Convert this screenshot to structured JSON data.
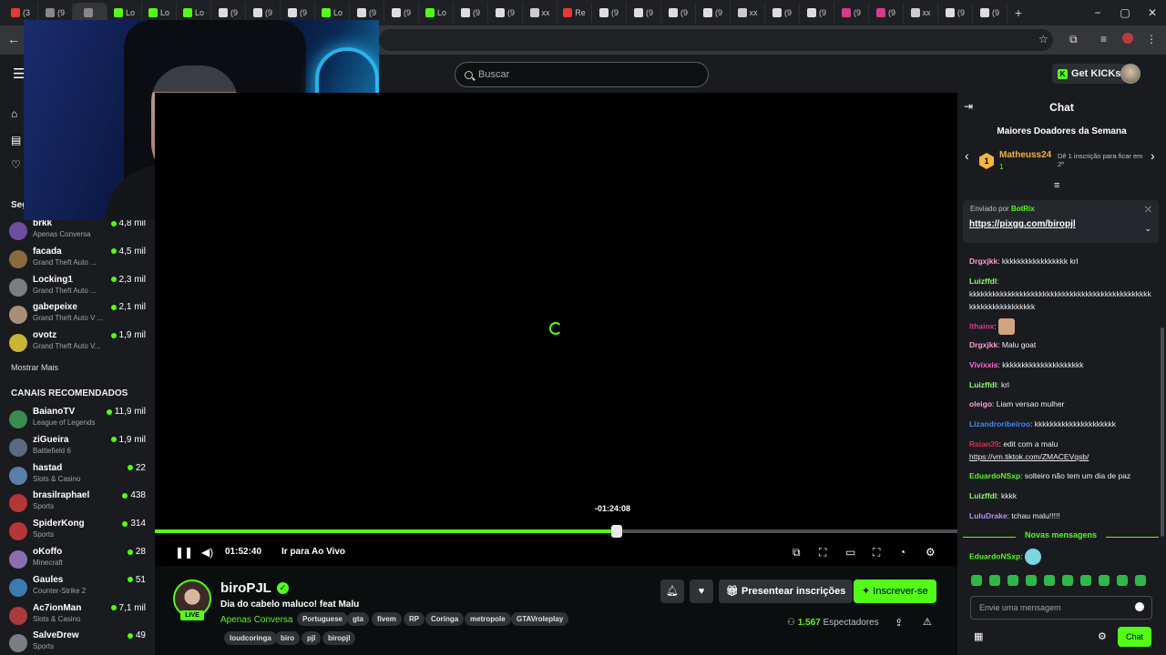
{
  "browser": {
    "tabs": [
      "(3",
      "(9",
      "",
      "Lo",
      "Lo",
      "Lo",
      "(9",
      "(9",
      "(9",
      "Lo",
      "(9",
      "(9",
      "Lo",
      "(9",
      "(9",
      "xx",
      "Re",
      "(9",
      "(9",
      "(9",
      "(9",
      "xx",
      "(9",
      "(9",
      "(9",
      "(9",
      "xx",
      "(9",
      "(9"
    ],
    "new_tab": "+",
    "window_controls": [
      "−",
      "▢",
      "✕"
    ]
  },
  "header": {
    "search_placeholder": "Buscar",
    "get_kicks": "Get KICKs"
  },
  "sidebar": {
    "following_title": "Seg",
    "following": [
      {
        "name": "brkk",
        "category": "Apenas Conversa",
        "viewers": "4,8 mil",
        "color": "#6b4f9e"
      },
      {
        "name": "facada",
        "category": "Grand Theft Auto ...",
        "viewers": "4,5 mil",
        "color": "#8a6a3c"
      },
      {
        "name": "Locking1",
        "category": "Grand Theft Auto ...",
        "viewers": "2,3 mil",
        "color": "#7a7d82"
      },
      {
        "name": "gabepeixe",
        "category": "Grand Theft Auto V ...",
        "viewers": "2,1 mil",
        "color": "#a98f7a"
      },
      {
        "name": "ovotz",
        "category": "Grand Theft Auto V...",
        "viewers": "1,9 mil",
        "color": "#c9b534"
      }
    ],
    "show_more": "Mostrar Mais",
    "recommended_title": "CANAIS RECOMENDADOS",
    "recommended": [
      {
        "name": "BaianoTV",
        "category": "League of Legends",
        "viewers": "11,9 mil",
        "color": "#3c8a4f"
      },
      {
        "name": "ziGueira",
        "category": "Battlefield 6",
        "viewers": "1,9 mil",
        "color": "#5d6a7e"
      },
      {
        "name": "hastad",
        "category": "Slots & Casino",
        "viewers": "22",
        "color": "#5a7fa8"
      },
      {
        "name": "brasilraphael",
        "category": "Sports",
        "viewers": "438",
        "color": "#b43636"
      },
      {
        "name": "SpiderKong",
        "category": "Sports",
        "viewers": "314",
        "color": "#b43636"
      },
      {
        "name": "oKoffo",
        "category": "Minecraft",
        "viewers": "28",
        "color": "#8a6fb0"
      },
      {
        "name": "Gaules",
        "category": "Counter-Strike 2",
        "viewers": "51",
        "color": "#3c7ab0"
      },
      {
        "name": "Ac7ionMan",
        "category": "Slots & Casino",
        "viewers": "7,1 mil",
        "color": "#a83c3c"
      },
      {
        "name": "SalveDrew",
        "category": "Sports",
        "viewers": "49",
        "color": "#7a7d82"
      }
    ]
  },
  "player": {
    "seek_tooltip": "-01:24:08",
    "seek_progress": 0.575,
    "time": "01:52:40",
    "go_live": "Ir para Ao Vivo"
  },
  "channel": {
    "name": "biroPJL",
    "live": "LIVE",
    "title": "Dia do cabelo maluco! feat Malu",
    "category": "Apenas Conversa",
    "tags_row1": [
      "Portuguese",
      "gta",
      "fivem",
      "RP",
      "Coringa",
      "metropole",
      "GTAVroleplay"
    ],
    "tags_row2": [
      "loudcoringa",
      "biro",
      "pjl",
      "biropjl"
    ],
    "gift_label": "Presentear inscrições",
    "subscribe_label": "Inscrever-se",
    "viewer_count": "1.567",
    "viewer_label": "Espectadores"
  },
  "chat": {
    "title": "Chat",
    "donors_title": "Maiores Doadores da Semana",
    "top_donor": {
      "rank": "1",
      "name": "Matheuss24",
      "count": "1"
    },
    "donor_cta": "Dê 1 inscrição para ficar em 2º",
    "pinned_by": "Enviado por",
    "pinned_bot": "BotRix",
    "pinned_link": "https://pixgg.com/biropjl",
    "messages": [
      {
        "user": "Drgxjkk",
        "color": "#ff9ad5",
        "text": ": kkkkkkkkkkkkkkkkk krl"
      },
      {
        "user": "Luizffdl",
        "color": "#8fff6b",
        "text": ":"
      },
      {
        "user": "",
        "color": "#efeff1",
        "text": "kkkkkkkkkkkkkkkkkkkkkkkkkkkkkkkkkkkkkkkkkkkkkkkkkkkkkkkkkkkkkkkk"
      },
      {
        "user": "lthaiox",
        "color": "#d63c8a",
        "text": ":"
      },
      {
        "user": "Drgxjkk",
        "color": "#ff9ad5",
        "text": ": Malu goat"
      },
      {
        "user": "Vivixxis",
        "color": "#ff6bd0",
        "text": ": kkkkkkkkkkkkkkkkkkkkk"
      },
      {
        "user": "Luizffdl",
        "color": "#8fff6b",
        "text": ": krl"
      },
      {
        "user": "oleigo",
        "color": "#ff9ad5",
        "text": ": Liam versao mulher"
      },
      {
        "user": "Lizandroribeiroo",
        "color": "#3c8cff",
        "text": ": kkkkkkkkkkkkkkkkkkkkk"
      },
      {
        "user": "Raian39",
        "color": "#d6304f",
        "text": ": edit com a malu"
      },
      {
        "user": "",
        "color": "#efeff1",
        "text": "https://vm.tiktok.com/ZMACEVqsb/"
      },
      {
        "user": "EduardoNSxp",
        "color": "#53fc18",
        "text": ": solteiro não tem um dia de paz"
      },
      {
        "user": "Luizffdl",
        "color": "#8fff6b",
        "text": ": kkkk"
      },
      {
        "user": "LuluDrake",
        "color": "#c28bff",
        "text": ": tchau malu!!!!!"
      }
    ],
    "new_messages": "Novas mensagens",
    "last_message_user": "EduardoNSxp",
    "input_placeholder": "Envie uma mensagem",
    "send_label": "Chat"
  },
  "colors": {
    "accent": "#53fc18",
    "bg": "#0b0e0f",
    "panel": "#191b1f"
  }
}
